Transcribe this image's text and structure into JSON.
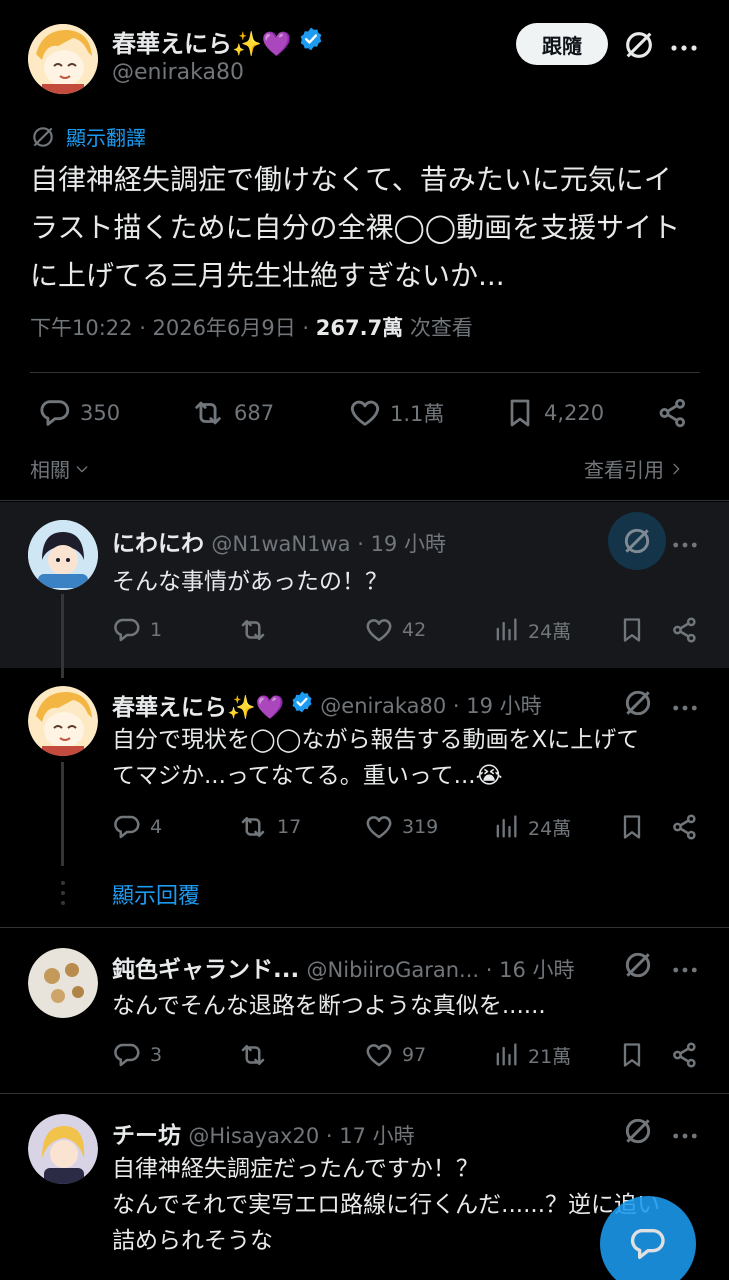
{
  "main": {
    "name": "春華えにら✨💜",
    "handle": "@eniraka80",
    "follow_label": "跟隨",
    "translate_label": "顯示翻譯",
    "text_lines": [
      "自律神経失調症で働けなくて、昔みたいに元気にイ",
      "ラスト描くために自分の全裸◯◯動画を支援サイト",
      "に上げてる三月先生壮絶すぎないか..."
    ],
    "time": "下午10:22 · 2026年6月9日 · ",
    "views_value": "267.7萬",
    "views_label": " 次查看",
    "replies": "350",
    "retweets": "687",
    "likes": "1.1萬",
    "bookmarks": "4,220",
    "related_label": "相關",
    "quotes_label": "查看引用"
  },
  "replies": [
    {
      "name": "にわにわ",
      "handle": "@N1waN1wa · 19 小時",
      "text": "そんな事情があったの！？",
      "replies": "1",
      "retweets": "",
      "likes": "42",
      "views": "24萬"
    },
    {
      "name": "春華えにら✨💜",
      "handle": "@eniraka80 · 19 小時",
      "text1": "自分で現状を◯◯ながら報告する動画をXに上げて",
      "text2": "てマジか...ってなてる。重いって...😭",
      "replies": "4",
      "retweets": "17",
      "likes": "319",
      "views": "24萬"
    },
    {
      "name": "鈍色ギャランド...",
      "handle": "@NibiiroGaran... · 16 小時",
      "text": "なんでそんな退路を断つような真似を......",
      "replies": "3",
      "retweets": "",
      "likes": "97",
      "views": "21萬"
    },
    {
      "name": "チー坊",
      "handle": "@Hisayax20 · 17 小時",
      "text1": "自律神経失調症だったんですか！？",
      "text2": "なんでそれで実写エロ路線に行くんだ......？逆に追い",
      "text3": "詰められそうな"
    }
  ],
  "show_replies_label": "顯示回覆",
  "colors": {
    "accent": "#1d9bf0",
    "bg": "#000000",
    "text": "#e7e9ea",
    "muted": "#71767b",
    "like": "#f91880"
  }
}
